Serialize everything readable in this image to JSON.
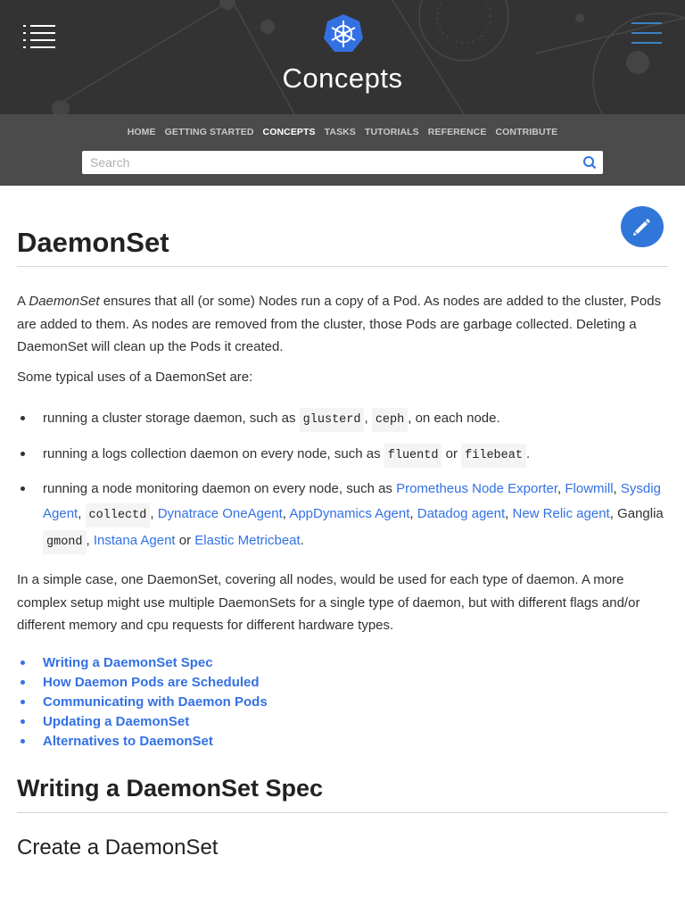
{
  "header": {
    "title": "Concepts",
    "logo_icon": "kubernetes-helm-icon",
    "left_menu_icon": "sidebar-menu-icon",
    "right_menu_icon": "hamburger-menu-icon"
  },
  "nav": {
    "items": [
      {
        "label": "HOME"
      },
      {
        "label": "GETTING STARTED"
      },
      {
        "label": "CONCEPTS",
        "active": true
      },
      {
        "label": "TASKS"
      },
      {
        "label": "TUTORIALS"
      },
      {
        "label": "REFERENCE"
      },
      {
        "label": "CONTRIBUTE"
      }
    ]
  },
  "search": {
    "placeholder": "Search",
    "icon": "search-icon"
  },
  "page": {
    "title": "DaemonSet",
    "edit_icon": "pencil-icon",
    "intro": {
      "a": "A ",
      "em": "DaemonSet",
      "rest": " ensures that all (or some) Nodes run a copy of a Pod. As nodes are added to the cluster, Pods are added to them. As nodes are removed from the cluster, those Pods are garbage collected. Deleting a DaemonSet will clean up the Pods it created."
    },
    "uses_intro": "Some typical uses of a DaemonSet are:",
    "use1": {
      "pre": "running a cluster storage daemon, such as ",
      "c1": "glusterd",
      "sep": ", ",
      "c2": "ceph",
      "post": ", on each node."
    },
    "use2": {
      "pre": "running a logs collection daemon on every node, such as ",
      "c1": "fluentd",
      "mid": " or ",
      "c2": "filebeat",
      "post": "."
    },
    "use3": {
      "pre": "running a node monitoring daemon on every node, such as ",
      "l1": "Prometheus Node Exporter",
      "l2": "Flowmill",
      "l3": "Sysdig Agent",
      "c1": "collectd",
      "l4": "Dynatrace OneAgent",
      "l5": "AppDynamics Agent",
      "l6": "Datadog agent",
      "l7": "New Relic agent",
      "t1": "Ganglia",
      "c2": "gmond",
      "l8": "Instana Agent",
      "t2": "or",
      "l9": "Elastic Metricbeat"
    },
    "simple_case": "In a simple case, one DaemonSet, covering all nodes, would be used for each type of daemon. A more complex setup might use multiple DaemonSets for a single type of daemon, but with different flags and/or different memory and cpu requests for different hardware types.",
    "toc": [
      "Writing a DaemonSet Spec",
      "How Daemon Pods are Scheduled",
      "Communicating with Daemon Pods",
      "Updating a DaemonSet",
      "Alternatives to DaemonSet"
    ],
    "h2": "Writing a DaemonSet Spec",
    "h3": "Create a DaemonSet"
  }
}
